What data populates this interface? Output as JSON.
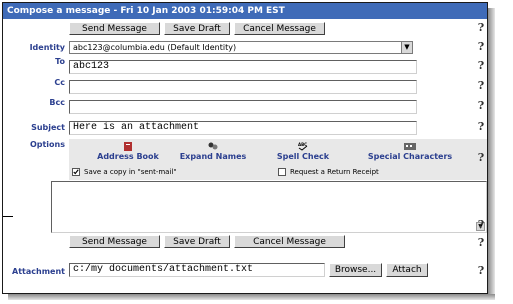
{
  "title": "Compose a message - Fri 10 Jan 2003 01:59:04 PM EST",
  "buttons": {
    "send": "Send Message",
    "draft": "Save Draft",
    "cancel": "Cancel Message",
    "browse": "Browse...",
    "attach": "Attach"
  },
  "labels": {
    "identity": "Identity",
    "to": "To",
    "cc": "Cc",
    "bcc": "Bcc",
    "subject": "Subject",
    "options": "Options",
    "attachment": "Attachment"
  },
  "identity_value": "abc123@columbia.edu (Default Identity)",
  "to_value": "abc123",
  "cc_value": "",
  "bcc_value": "",
  "subject_value": "Here is an attachment",
  "tools": {
    "address_book": "Address Book",
    "expand_names": "Expand Names",
    "spell_check": "Spell Check",
    "special_characters": "Special Characters"
  },
  "checkboxes": {
    "save_copy": {
      "label": "Save a copy in \"sent-mail\"",
      "checked": true
    },
    "return_receipt": {
      "label": "Request a Return Receipt",
      "checked": false
    }
  },
  "attachment_value": "c:/my documents/attachment.txt",
  "help_glyph": "?",
  "colors": {
    "titlebar": "#3f6bb8",
    "label": "#2b3f8f"
  }
}
